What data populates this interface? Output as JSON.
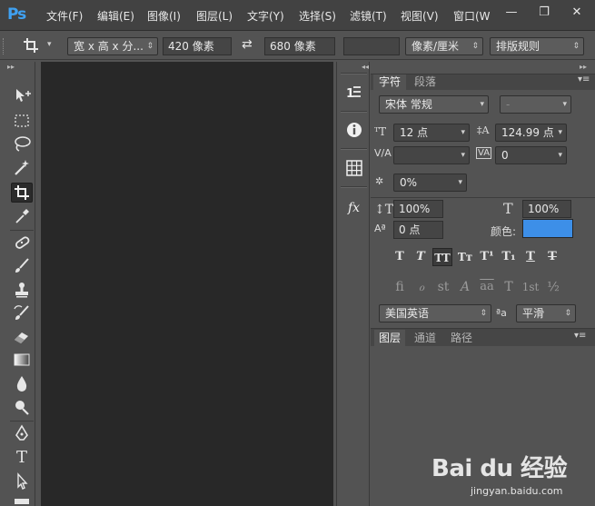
{
  "app": {
    "logo": "Ps"
  },
  "menu": [
    "文件(F)",
    "编辑(E)",
    "图像(I)",
    "图层(L)",
    "文字(Y)",
    "选择(S)",
    "滤镜(T)",
    "视图(V)",
    "窗口(W"
  ],
  "window_controls": {
    "minimize": "—",
    "restore": "❐",
    "close": "✕"
  },
  "options_bar": {
    "crop_icon": "crop-icon",
    "ratio_preset": "宽 x 高 x 分...",
    "width": "420 像素",
    "swap_icon": "⇄",
    "height": "680 像素",
    "resolution": "",
    "resolution_unit": "像素/厘米",
    "arrangement": "排版规则"
  },
  "tools": [
    "move-tool",
    "marquee-tool",
    "lasso-tool",
    "magic-wand-tool",
    "crop-tool",
    "eyedropper-tool",
    "healing-brush-tool",
    "brush-tool",
    "clone-stamp-tool",
    "history-brush-tool",
    "eraser-tool",
    "gradient-tool",
    "blur-tool",
    "dodge-tool",
    "pen-tool",
    "type-tool",
    "path-selection-tool"
  ],
  "dock": {
    "collapse": "◂◂",
    "expand": "▸▸"
  },
  "character_panel": {
    "tabs": [
      "字符",
      "段落"
    ],
    "font_family": "宋体 常规",
    "font_style": "-",
    "font_size": "12 点",
    "leading": "124.99 点",
    "kerning": "",
    "tracking": "0",
    "scale_proportion": "0%",
    "vertical_scale": "100%",
    "horizontal_scale": "100%",
    "baseline_shift": "0 点",
    "color_label": "颜色:",
    "color_value": "#3d8fe8",
    "style_buttons": [
      "T",
      "T",
      "TT",
      "Tт",
      "T¹",
      "T₁",
      "T",
      "T"
    ],
    "opentype_buttons": [
      "fi",
      "ℴ",
      "st",
      "A",
      "aa",
      "T",
      "1st",
      "½"
    ],
    "language": "美国英语",
    "aa_icon": "ªa",
    "antialias": "平滑"
  },
  "layers_panel": {
    "tabs": [
      "图层",
      "通道",
      "路径"
    ]
  },
  "watermark": {
    "brand": "Bai du 经验",
    "url": "jingyan.baidu.com"
  }
}
